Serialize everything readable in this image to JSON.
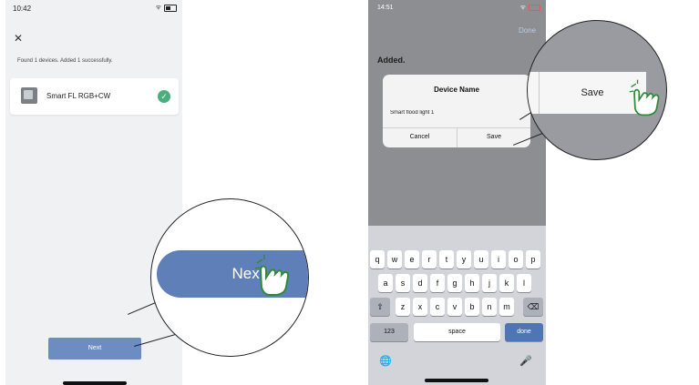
{
  "left": {
    "status_time": "10:42",
    "status_icons": "ᯤ",
    "close_icon": "✕",
    "found_text": "Found 1 devices. Added 1 successfully.",
    "device_name": "Smart FL RGB+CW",
    "check_icon": "✓",
    "next_label": "Next",
    "zoom_next_label": "Next"
  },
  "right": {
    "status_time": "14:51",
    "status_icons": "ᯤ",
    "done_label": "Done",
    "added_label": "Added.",
    "dialog": {
      "title": "Device Name",
      "input_value": "Smart flood light 1",
      "cancel_label": "Cancel",
      "save_label": "Save"
    },
    "zoom_save_label": "Save",
    "keyboard": {
      "row1": [
        "q",
        "w",
        "e",
        "r",
        "t",
        "y",
        "u",
        "i",
        "o",
        "p"
      ],
      "row2": [
        "a",
        "s",
        "d",
        "f",
        "g",
        "h",
        "j",
        "k",
        "l"
      ],
      "row3": [
        "z",
        "x",
        "c",
        "v",
        "b",
        "n",
        "m"
      ],
      "shift_icon": "⇧",
      "backspace_icon": "⌫",
      "numbers_label": "123",
      "space_label": "space",
      "done_label": "done",
      "globe_icon": "🌐",
      "mic_icon": "🎤"
    }
  },
  "colors": {
    "primary_button": "#6c8cc2",
    "success": "#4caf7b",
    "keyboard_done": "#4f75b5"
  }
}
